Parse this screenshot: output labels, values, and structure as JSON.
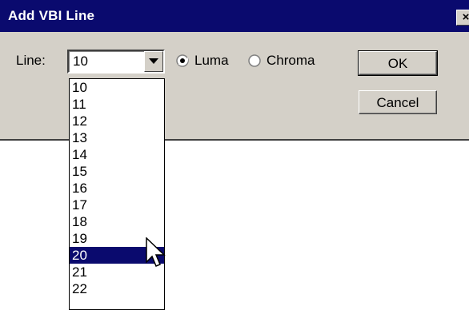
{
  "window": {
    "title": "Add VBI Line",
    "close_glyph": "×"
  },
  "line_field": {
    "label": "Line:",
    "value": "10"
  },
  "signal": {
    "options": [
      {
        "label": "Luma",
        "selected": true
      },
      {
        "label": "Chroma",
        "selected": false
      }
    ]
  },
  "buttons": {
    "ok": "OK",
    "cancel": "Cancel"
  },
  "dropdown": {
    "items": [
      "10",
      "11",
      "12",
      "13",
      "14",
      "15",
      "16",
      "17",
      "18",
      "19",
      "20",
      "21",
      "22"
    ],
    "highlighted": "20"
  },
  "colors": {
    "titlebar": "#0a0a6e",
    "dialog_face": "#d4d0c8",
    "selection": "#0a0a6e"
  },
  "icons": {
    "combo_arrow": "chevron-down-icon",
    "pointer": "mouse-pointer-icon"
  }
}
